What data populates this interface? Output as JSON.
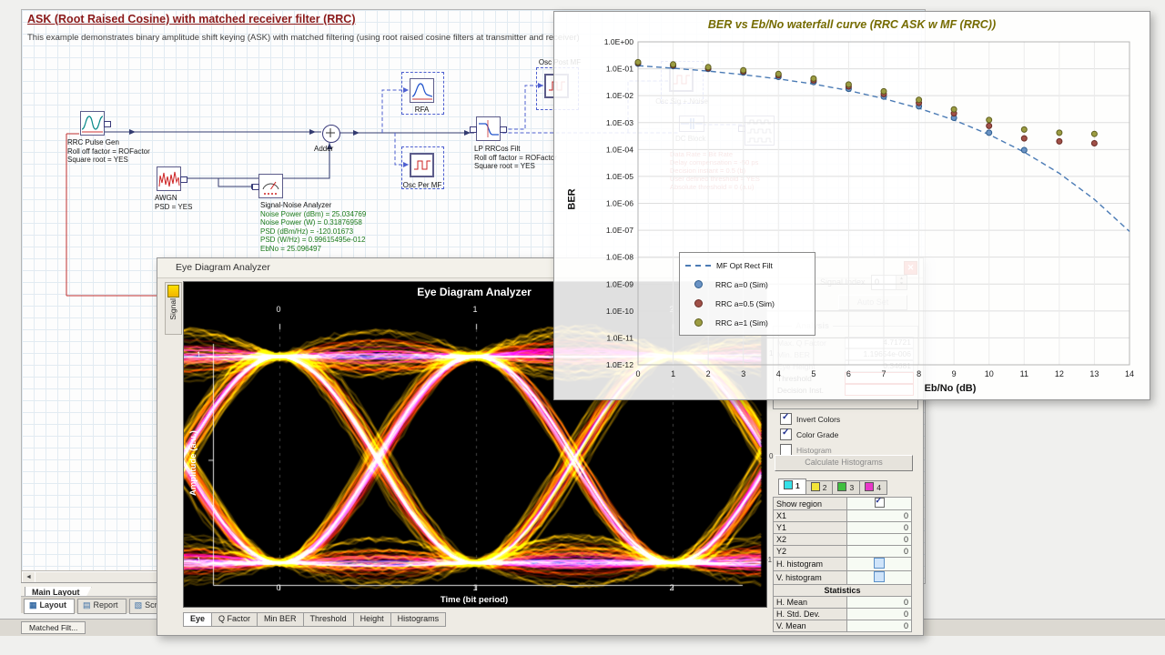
{
  "app": {
    "background": "#f0f0ee"
  },
  "schematic": {
    "title": "ASK (Root Raised Cosine) with matched receiver filter (RRC)",
    "subtitle": "This example demonstrates binary amplitude shift keying (ASK) with matched filtering (using root raised cosine filters at transmitter and receiver)",
    "blocks": {
      "rrc_pulse_gen": {
        "label": "RRC Pulse Gen",
        "params": [
          "Roll off factor = ROFactor",
          "Square root = YES"
        ]
      },
      "awgn": {
        "label": "AWGN",
        "params": [
          "PSD = YES"
        ]
      },
      "adder": {
        "label": "Adder"
      },
      "rfa": {
        "label": "RFA"
      },
      "osc_per_mf": {
        "label": "Osc Per MF"
      },
      "lp_rrcos": {
        "label": "LP RRCos Filt",
        "params": [
          "Roll off factor = ROFactor",
          "Square root = YES"
        ]
      },
      "osc_post_mf": {
        "label": "Osc Post MF"
      },
      "sna": {
        "label": "Signal-Noise Analyzer",
        "params": [
          "Noise Power (dBm) = 25.034769",
          "Noise Power (W) = 0.31876958",
          "PSD (dBm/Hz) = -120.01673",
          "PSD (W/Hz) = 0.99615495e-012",
          "EbNo = 25.096497"
        ]
      },
      "osc_sig_noise": {
        "label": "Osc Sig + Noise"
      },
      "dc_block": {
        "label": "DC Block"
      },
      "ber_test_params": [
        "Data Rate = Bit Rate",
        "Delay compensation = -50 ps",
        "Decision instant = 0.5 (b)",
        "User defined threshold = YES",
        "Absolute threshold = 0 (a.u)"
      ]
    }
  },
  "chart_data": {
    "type": "line+scatter",
    "title": "BER vs Eb/No waterfall curve (RRC ASK w MF (RRC))",
    "xlabel": "Eb/No (dB)",
    "ylabel": "BER",
    "xlim": [
      0,
      14
    ],
    "y_scale": "log",
    "ylim": [
      1e-12,
      1
    ],
    "grid": true,
    "legend_position": "inside-lower-left",
    "series": [
      {
        "name": "MF Opt Rect Filt",
        "marker": "dashed-line",
        "color": "#4b7bb5",
        "edge": "#2f5e8f",
        "x": [
          0,
          1,
          2,
          3,
          4,
          5,
          6,
          7,
          8,
          9,
          10,
          11,
          12,
          13,
          14
        ],
        "y": [
          0.13,
          0.105,
          0.082,
          0.06,
          0.042,
          0.027,
          0.0155,
          0.0078,
          0.0034,
          0.00125,
          0.00036,
          8e-05,
          1.3e-05,
          1.4e-06,
          9e-08
        ]
      },
      {
        "name": "RRC a=0 (Sim)",
        "marker": "dot",
        "color": "#6b93c4",
        "edge": "#2f5e8f",
        "x": [
          0,
          1,
          2,
          3,
          4,
          5,
          6,
          7,
          8,
          9,
          10,
          11
        ],
        "y": [
          0.155,
          0.125,
          0.098,
          0.072,
          0.05,
          0.032,
          0.018,
          0.0092,
          0.004,
          0.0015,
          0.00042,
          9.5e-05
        ]
      },
      {
        "name": "RRC a=0.5 (Sim)",
        "marker": "dot",
        "color": "#a05048",
        "edge": "#6b2d26",
        "x": [
          0,
          1,
          2,
          3,
          4,
          5,
          6,
          7,
          8,
          9,
          10,
          11,
          12,
          13
        ],
        "y": [
          0.165,
          0.135,
          0.105,
          0.08,
          0.057,
          0.037,
          0.022,
          0.0115,
          0.0054,
          0.0022,
          0.00075,
          0.00026,
          0.0002,
          0.00017
        ]
      },
      {
        "name": "RRC a=1 (Sim)",
        "marker": "dot",
        "color": "#9c9c42",
        "edge": "#5f5f20",
        "x": [
          0,
          1,
          2,
          3,
          4,
          5,
          6,
          7,
          8,
          9,
          10,
          11,
          12,
          13
        ],
        "y": [
          0.175,
          0.145,
          0.115,
          0.088,
          0.064,
          0.043,
          0.026,
          0.0145,
          0.007,
          0.0031,
          0.00125,
          0.00055,
          0.00042,
          0.00038
        ]
      }
    ]
  },
  "eye_window": {
    "titlebar": "Eye Diagram Analyzer",
    "side_tab": "Signal",
    "plot": {
      "title": "Eye Diagram Analyzer",
      "xlabel": "Time (bit period)",
      "ylabel": "Amplitude (a.u.)",
      "x_ticks": [
        "0",
        "1",
        "2"
      ],
      "y_ticks_left": [
        "1",
        "-1"
      ],
      "y_ticks_right": [
        "1",
        "0",
        "-1"
      ]
    },
    "bottom_tabs": [
      "Eye",
      "Q Factor",
      "Min BER",
      "Threshold",
      "Height",
      "Histograms"
    ],
    "active_bottom_tab": "Eye",
    "panel": {
      "signal_index_label": "Signal Index",
      "signal_index_value": "0",
      "auto_set": "Auto Set",
      "analysis_title": "Analysis",
      "analysis_rows": [
        {
          "label": "Max. Q Factor",
          "value": "4.71721",
          "state": "disabled"
        },
        {
          "label": "Min. BER",
          "value": "1.19654e-006",
          "state": "disabled"
        },
        {
          "label": "Eye Height",
          "value": "0.34681",
          "state": "disabled"
        },
        {
          "label": "Threshold",
          "value": "",
          "state": "error"
        },
        {
          "label": "Decision Inst.",
          "value": "",
          "state": "error"
        }
      ],
      "checkboxes": [
        {
          "label": "Invert Colors",
          "checked": true,
          "disabled": false
        },
        {
          "label": "Color Grade",
          "checked": true,
          "disabled": false
        },
        {
          "label": "Histogram",
          "checked": false,
          "disabled": true
        }
      ],
      "calc_button": "Calculate Histograms",
      "color_tabs": [
        {
          "label": "1",
          "color": "#35e0e8"
        },
        {
          "label": "2",
          "color": "#f2e437"
        },
        {
          "label": "3",
          "color": "#3fbf3f"
        },
        {
          "label": "4",
          "color": "#e838c8"
        }
      ],
      "region_table": {
        "rows": [
          {
            "label": "Show region",
            "type": "checkbox",
            "checked": true
          },
          {
            "label": "X1",
            "value": "0"
          },
          {
            "label": "Y1",
            "value": "0"
          },
          {
            "label": "X2",
            "value": "0"
          },
          {
            "label": "Y2",
            "value": "0"
          },
          {
            "label": "H. histogram",
            "type": "bluebox"
          },
          {
            "label": "V. histogram",
            "type": "bluebox"
          },
          {
            "label": "Statistics",
            "type": "header"
          },
          {
            "label": "H. Mean",
            "value": "0"
          },
          {
            "label": "H. Std. Dev.",
            "value": "0"
          },
          {
            "label": "V. Mean",
            "value": "0"
          }
        ]
      }
    }
  },
  "bottom_bars": {
    "layout_tab": "Main Layout",
    "project_tabs": [
      "Layout",
      "Report",
      "Scri"
    ],
    "active_project_tab": "Layout",
    "task_tab": "Matched Filt..."
  }
}
